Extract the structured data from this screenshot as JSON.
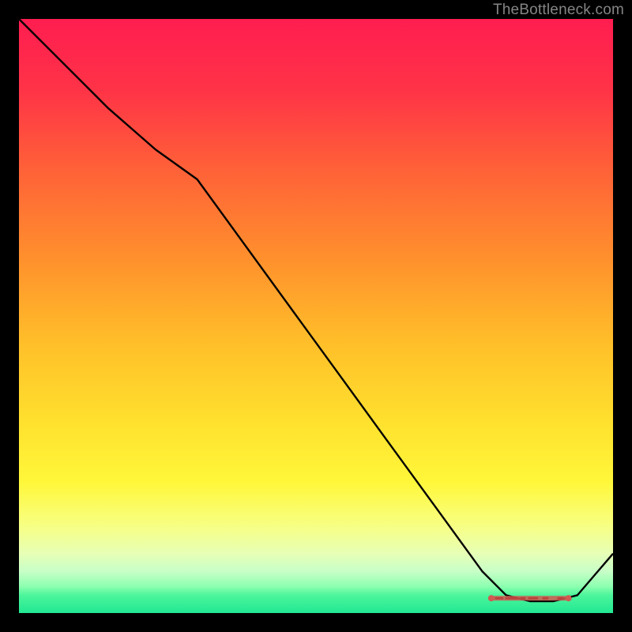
{
  "watermark": "TheBottleneck.com",
  "chart_data": {
    "type": "line",
    "title": "",
    "xlabel": "",
    "ylabel": "",
    "xlim": [
      0,
      100
    ],
    "ylim": [
      0,
      100
    ],
    "background_gradient_stops": [
      {
        "offset": 0,
        "color": "#ff1d50"
      },
      {
        "offset": 12,
        "color": "#ff3347"
      },
      {
        "offset": 25,
        "color": "#ff6038"
      },
      {
        "offset": 40,
        "color": "#ff8f2d"
      },
      {
        "offset": 55,
        "color": "#ffc029"
      },
      {
        "offset": 68,
        "color": "#ffe12e"
      },
      {
        "offset": 78,
        "color": "#fff73a"
      },
      {
        "offset": 85,
        "color": "#f8ff80"
      },
      {
        "offset": 90,
        "color": "#e7ffb6"
      },
      {
        "offset": 93,
        "color": "#c7ffc7"
      },
      {
        "offset": 95.5,
        "color": "#8effb0"
      },
      {
        "offset": 97,
        "color": "#4cf59b"
      },
      {
        "offset": 100,
        "color": "#21e893"
      }
    ],
    "series": [
      {
        "name": "curve",
        "color": "#000000",
        "x": [
          0,
          8,
          15,
          23,
          30,
          38,
          46,
          54,
          62,
          70,
          78,
          82,
          86,
          90,
          94,
          100
        ],
        "y": [
          100,
          92,
          85,
          78,
          73,
          62,
          51,
          40,
          29,
          18,
          7,
          3,
          2,
          2,
          3,
          10
        ]
      }
    ],
    "markers": {
      "name": "optimal-range",
      "color": "#d15a52",
      "shape": "hline-dots",
      "x_center": 86,
      "y": 2.5,
      "half_width_x": 6.5
    }
  }
}
